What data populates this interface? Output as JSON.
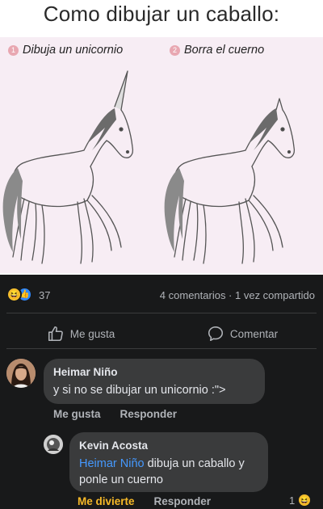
{
  "meme": {
    "title": "Como dibujar un caballo:",
    "steps": [
      {
        "number": "1",
        "label": "Dibuja un unicornio"
      },
      {
        "number": "2",
        "label": "Borra el cuerno"
      }
    ]
  },
  "post": {
    "reaction_count": "37",
    "stats": "4 comentarios · 1 vez compartido",
    "like_label": "Me gusta",
    "comment_label": "Comentar"
  },
  "comments": [
    {
      "author": "Heimar Niño",
      "text": "y si no se dibujar un unicornio :\">",
      "actions": [
        "Me gusta",
        "Responder"
      ]
    },
    {
      "author": "Kevin Acosta",
      "mention": "Heimar Niño",
      "text": " dibuja un caballo y ponle un cuerno",
      "actions": [
        "Me divierte",
        "Responder"
      ],
      "reaction_count": "1"
    }
  ],
  "icons": {
    "reactions": [
      "haha-icon",
      "like-icon"
    ],
    "like_action": "thumbs-up-icon",
    "comment_action": "speech-bubble-icon"
  },
  "colors": {
    "background_dark": "#18191a",
    "bubble": "#3a3b3c",
    "mention": "#4599ff",
    "haha": "#f7c22f",
    "like": "#2e89ff",
    "panel_pink": "#f7edf4"
  }
}
